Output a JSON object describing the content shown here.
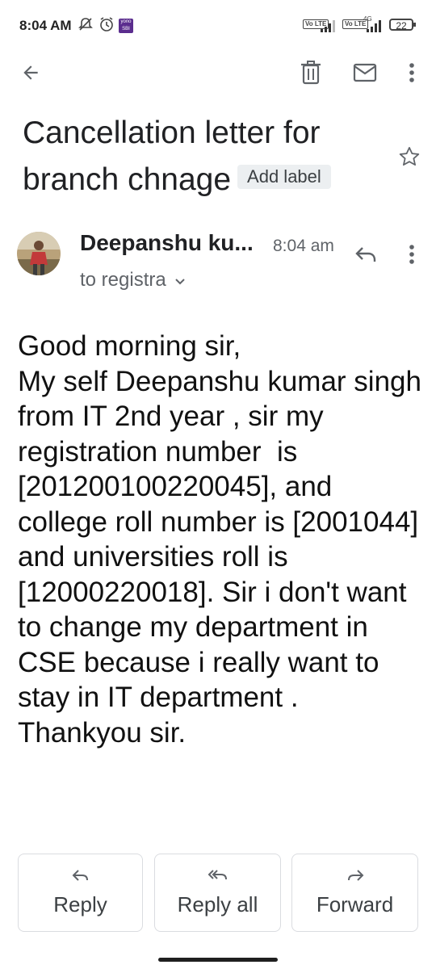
{
  "status_bar": {
    "time": "8:04 AM",
    "app_badge_text": "yono SBI",
    "volte_label": "Vo LTE",
    "network_type": "4G",
    "battery_level": "22",
    "icons": [
      "mute-notification-icon",
      "alarm-icon",
      "app-notification-icon",
      "signal-icon",
      "battery-icon"
    ]
  },
  "toolbar": {
    "icons": [
      "back-arrow-icon",
      "delete-icon",
      "mark-unread-icon",
      "more-options-icon"
    ]
  },
  "email": {
    "subject": "Cancellation letter for branch chnage",
    "label_chip": "Add label",
    "sender_name": "Deepanshu ku...",
    "time": "8:04 am",
    "recipient": "to registra",
    "body": "Good morning sir,\nMy self Deepanshu kumar singh from IT 2nd year , sir my registration number  is [2012001002200​45], and college roll number is [2001044] and universities roll is [12000220018]. Sir i don't want to change my department in CSE because i really want to stay in IT department .\nThankyou sir."
  },
  "actions": {
    "reply": "Reply",
    "reply_all": "Reply all",
    "forward": "Forward"
  },
  "colors": {
    "text_primary": "#202124",
    "text_secondary": "#5f6368",
    "chip_bg": "#eceff1",
    "border": "#dadce0"
  }
}
